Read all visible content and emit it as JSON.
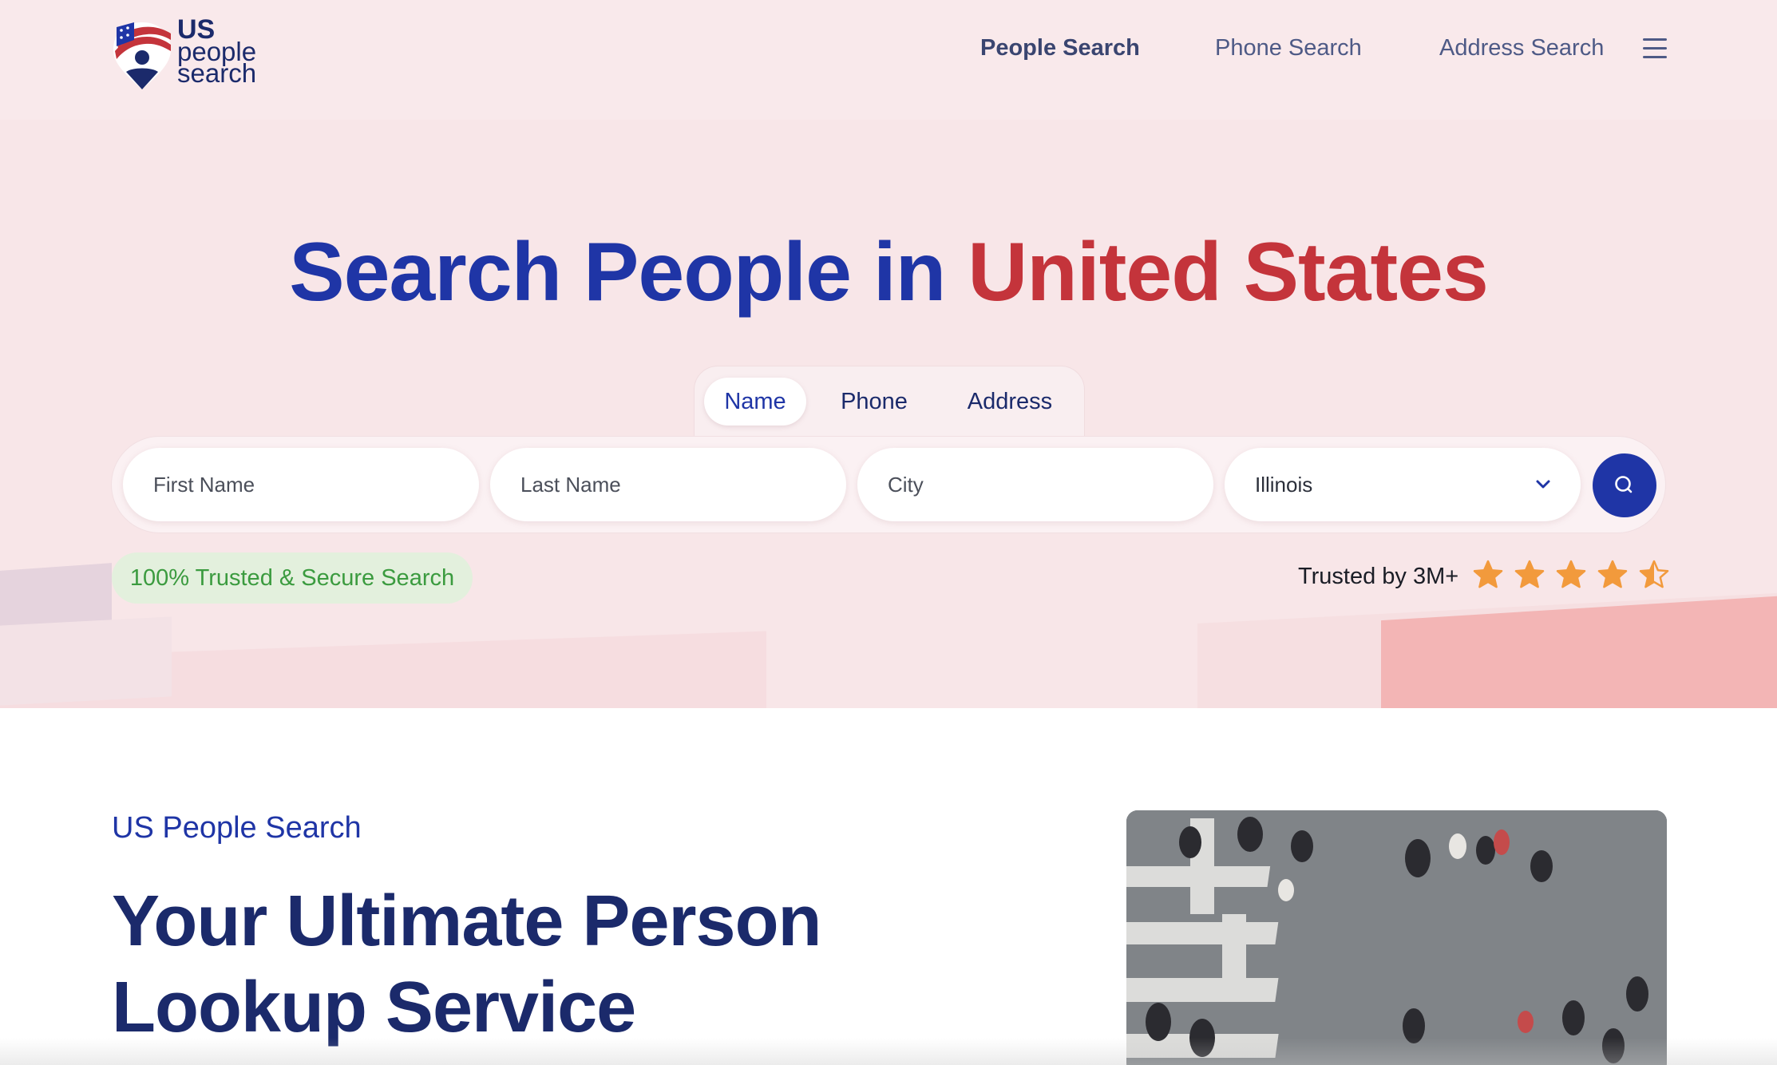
{
  "brand": {
    "line1": "US",
    "line2": "people",
    "line3": "search"
  },
  "nav": {
    "items": [
      {
        "label": "People Search",
        "active": true
      },
      {
        "label": "Phone Search",
        "active": false
      },
      {
        "label": "Address Search",
        "active": false
      }
    ],
    "menu_icon": "hamburger-menu-icon"
  },
  "hero": {
    "title_part1": "Search People in",
    "title_part2": "United States",
    "tabs": [
      {
        "label": "Name",
        "active": true
      },
      {
        "label": "Phone",
        "active": false
      },
      {
        "label": "Address",
        "active": false
      }
    ],
    "form": {
      "first_name_placeholder": "First Name",
      "last_name_placeholder": "Last Name",
      "city_placeholder": "City",
      "state_value": "Illinois",
      "search_icon": "search-icon"
    },
    "trust_badge": "100% Trusted & Secure Search",
    "trusted_by": "Trusted by 3M+",
    "rating": 4.5,
    "rating_max": 5
  },
  "section": {
    "kicker": "US People Search",
    "title": "Your Ultimate Person Lookup Service"
  },
  "colors": {
    "brand_blue": "#1f35a6",
    "brand_red": "#c4343b",
    "navy": "#1b2a6b",
    "star_orange": "#f29a3c",
    "hero_bg": "#f8e6e8",
    "badge_green": "#3b9b3f"
  }
}
